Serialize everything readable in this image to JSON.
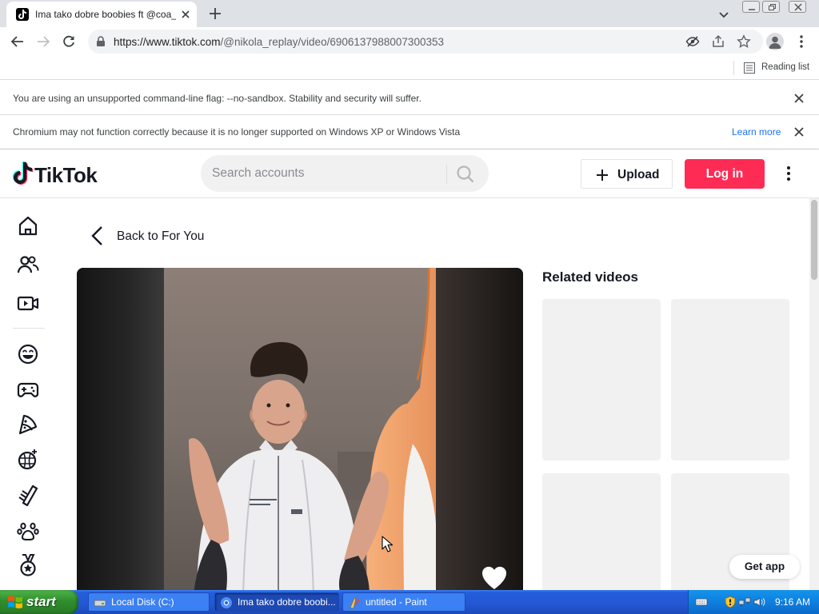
{
  "browser": {
    "tab_title": "Ima tako dobre boobies ft @coa_be",
    "url_host": "https://www.tiktok.com",
    "url_path": "/@nikola_replay/video/6906137988007300353",
    "reading_list": "Reading list",
    "infobars": [
      {
        "message": "You are using an unsupported command-line flag: --no-sandbox. Stability and security will suffer."
      },
      {
        "message": "Chromium may not function correctly because it is no longer supported on Windows XP or Windows Vista",
        "link": "Learn more"
      }
    ]
  },
  "tiktok": {
    "logo_text": "TikTok",
    "search_placeholder": "Search accounts",
    "upload_label": "Upload",
    "login_label": "Log in",
    "back_label": "Back to For You",
    "related_title": "Related videos",
    "get_app_label": "Get app",
    "sidebar_icons": [
      "home-icon",
      "following-icon",
      "live-icon",
      "comedy-icon",
      "gaming-icon",
      "food-icon",
      "dance-icon",
      "beauty-icon",
      "animals-icon",
      "sports-icon"
    ]
  },
  "taskbar": {
    "start_label": "start",
    "tasks": [
      {
        "label": "Local Disk (C:)",
        "icon": "drive-icon"
      },
      {
        "label": "Ima tako dobre boobi...",
        "icon": "chromium-icon",
        "active": true
      },
      {
        "label": "untitled - Paint",
        "icon": "paint-icon"
      }
    ],
    "clock": "9:16 AM"
  },
  "colors": {
    "tiktok_red": "#fe2c55",
    "xp_blue": "#245edb",
    "start_green": "#3c9a3a",
    "link_blue": "#1a73e8"
  }
}
